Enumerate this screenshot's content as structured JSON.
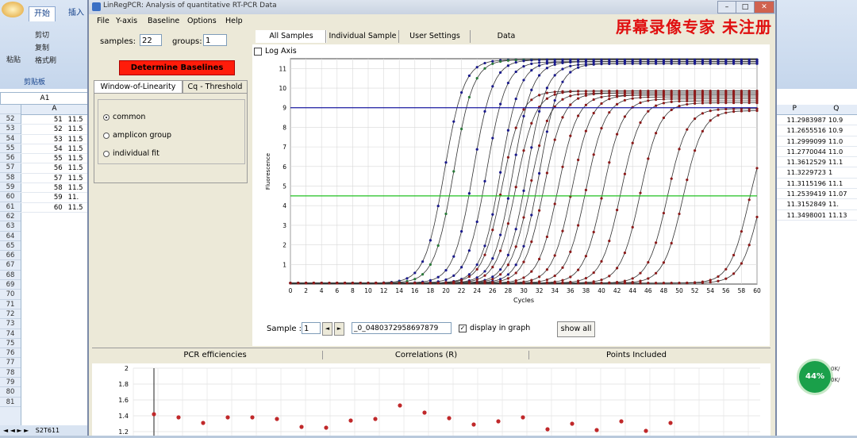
{
  "excel": {
    "tabs": [
      "开始",
      "插入"
    ],
    "clipboard": {
      "paste": "粘贴",
      "cut": "剪切",
      "copy": "复制",
      "format_painter": "格式刷",
      "group": "剪贴板"
    },
    "cell_ref": "A1",
    "col_a": "A",
    "row_numbers": [
      52,
      53,
      54,
      55,
      56,
      57,
      58,
      59,
      60,
      61,
      62,
      63,
      64,
      65,
      66,
      67,
      68,
      69,
      70,
      71,
      72,
      73,
      74,
      75,
      76,
      77,
      78,
      79,
      80,
      81
    ],
    "left_cells": [
      [
        "51",
        "11.5"
      ],
      [
        "52",
        "11.5"
      ],
      [
        "53",
        "11.5"
      ],
      [
        "54",
        "11.5"
      ],
      [
        "55",
        "11.5"
      ],
      [
        "56",
        "11.5"
      ],
      [
        "57",
        "11.5"
      ],
      [
        "58",
        "11.5"
      ],
      [
        "59",
        "11."
      ],
      [
        "60",
        "11.5"
      ]
    ],
    "right_cols": [
      "P",
      "Q"
    ],
    "right_cells": [
      [
        "11.2983987",
        "10.9"
      ],
      [
        "11.2655516",
        "10.9"
      ],
      [
        "11.2999099",
        "11.0"
      ],
      [
        "11.2770044",
        "11.0"
      ],
      [
        "11.3612529",
        "11.1"
      ],
      [
        "11.3229723",
        "1"
      ],
      [
        "11.3115196",
        "11.1"
      ],
      [
        "11.2539419",
        "11.07"
      ],
      [
        "11.3152849",
        "11."
      ],
      [
        "11.3498001",
        "11.13"
      ]
    ],
    "sheet_tab": "S2T611",
    "badge": "44%",
    "badge_side": [
      "0K/",
      "0K/"
    ]
  },
  "watermark": "屏幕录像专家 未注册",
  "window": {
    "title": "LinRegPCR: Analysis of quantitative RT-PCR Data",
    "menu": [
      "File",
      "Y-axis",
      "Baseline",
      "Options",
      "Help"
    ]
  },
  "left_panel": {
    "samples_label": "samples:",
    "samples_value": "22",
    "groups_label": "groups:",
    "groups_value": "1",
    "determine_button": "Determine Baselines",
    "tabs": [
      "Window-of-Linearity",
      "Cq - Threshold"
    ],
    "radios": [
      {
        "label": "common",
        "checked": true
      },
      {
        "label": "amplicon group",
        "checked": false
      },
      {
        "label": "individual fit",
        "checked": false
      }
    ]
  },
  "right_tabs": [
    "All Samples",
    "Individual Sample",
    "User Settings",
    "Data"
  ],
  "log_axis_label": "Log Axis",
  "chart_data": {
    "type": "line",
    "xlabel": "Cycles",
    "ylabel": "Fluorescence",
    "xlim": [
      0,
      60
    ],
    "ylim": [
      0,
      11.5
    ],
    "xticks": [
      0,
      2,
      4,
      6,
      8,
      10,
      12,
      14,
      16,
      18,
      20,
      22,
      24,
      26,
      28,
      30,
      32,
      34,
      36,
      38,
      40,
      42,
      44,
      46,
      48,
      50,
      52,
      54,
      56,
      58,
      60
    ],
    "yticks": [
      1,
      2,
      3,
      4,
      5,
      6,
      7,
      8,
      9,
      10,
      11
    ],
    "threshold_lines": [
      {
        "y": 9.0,
        "color": "#1a1aa0"
      },
      {
        "y": 4.5,
        "color": "#21c021"
      }
    ],
    "series": [
      {
        "color": "#1a1a8c",
        "midpoint": 19.8,
        "max": 11.4
      },
      {
        "color": "#2a7a3a",
        "midpoint": 21.0,
        "max": 11.4
      },
      {
        "color": "#1a1a8c",
        "midpoint": 23.5,
        "max": 11.4
      },
      {
        "color": "#1a1a8c",
        "midpoint": 25.2,
        "max": 11.3
      },
      {
        "color": "#1a1a8c",
        "midpoint": 27.0,
        "max": 11.3
      },
      {
        "color": "#1a1a8c",
        "midpoint": 28.6,
        "max": 11.3
      },
      {
        "color": "#1a1a8c",
        "midpoint": 30.4,
        "max": 11.2
      },
      {
        "color": "#1a1a8c",
        "midpoint": 32.0,
        "max": 11.2
      },
      {
        "color": "#8c1a1a",
        "midpoint": 27.2,
        "max": 9.8
      },
      {
        "color": "#8c1a1a",
        "midpoint": 29.0,
        "max": 9.8
      },
      {
        "color": "#8c1a1a",
        "midpoint": 30.8,
        "max": 9.7
      },
      {
        "color": "#8c1a1a",
        "midpoint": 32.6,
        "max": 9.7
      },
      {
        "color": "#8c1a1a",
        "midpoint": 34.4,
        "max": 9.6
      },
      {
        "color": "#8c1a1a",
        "midpoint": 36.2,
        "max": 9.6
      },
      {
        "color": "#8c1a1a",
        "midpoint": 38.0,
        "max": 9.5
      },
      {
        "color": "#8c1a1a",
        "midpoint": 40.2,
        "max": 9.4
      },
      {
        "color": "#8c1a1a",
        "midpoint": 42.5,
        "max": 9.3
      },
      {
        "color": "#8c1a1a",
        "midpoint": 45.0,
        "max": 9.2
      },
      {
        "color": "#8c1a1a",
        "midpoint": 48.5,
        "max": 8.9
      },
      {
        "color": "#8c1a1a",
        "midpoint": 50.5,
        "max": 8.8
      },
      {
        "color": "#8c1a1a",
        "midpoint": 59.0,
        "max": 8.5
      },
      {
        "color": "#8c1a1a",
        "midpoint": 60.5,
        "max": 8.4
      }
    ]
  },
  "sample_row": {
    "label": "Sample :",
    "value": "1",
    "prev": "◄",
    "next": "►",
    "sample_name": "_0_0480372958697879",
    "display_label": "display in graph",
    "display_checked": "✓",
    "show_all": "show all"
  },
  "bottom_tabs": [
    "PCR efficiencies",
    "Correlations (R)",
    "Points Included"
  ],
  "efficiency_chart": {
    "yticks": [
      "2",
      "1.8",
      "1.6",
      "1.4",
      "1.2"
    ],
    "values": [
      1.42,
      1.38,
      1.31,
      1.38,
      1.38,
      1.36,
      1.26,
      1.25,
      1.34,
      1.36,
      1.53,
      1.44,
      1.37,
      1.29,
      1.33,
      1.38,
      1.23,
      1.3,
      1.22,
      1.33,
      1.21,
      1.31
    ]
  }
}
